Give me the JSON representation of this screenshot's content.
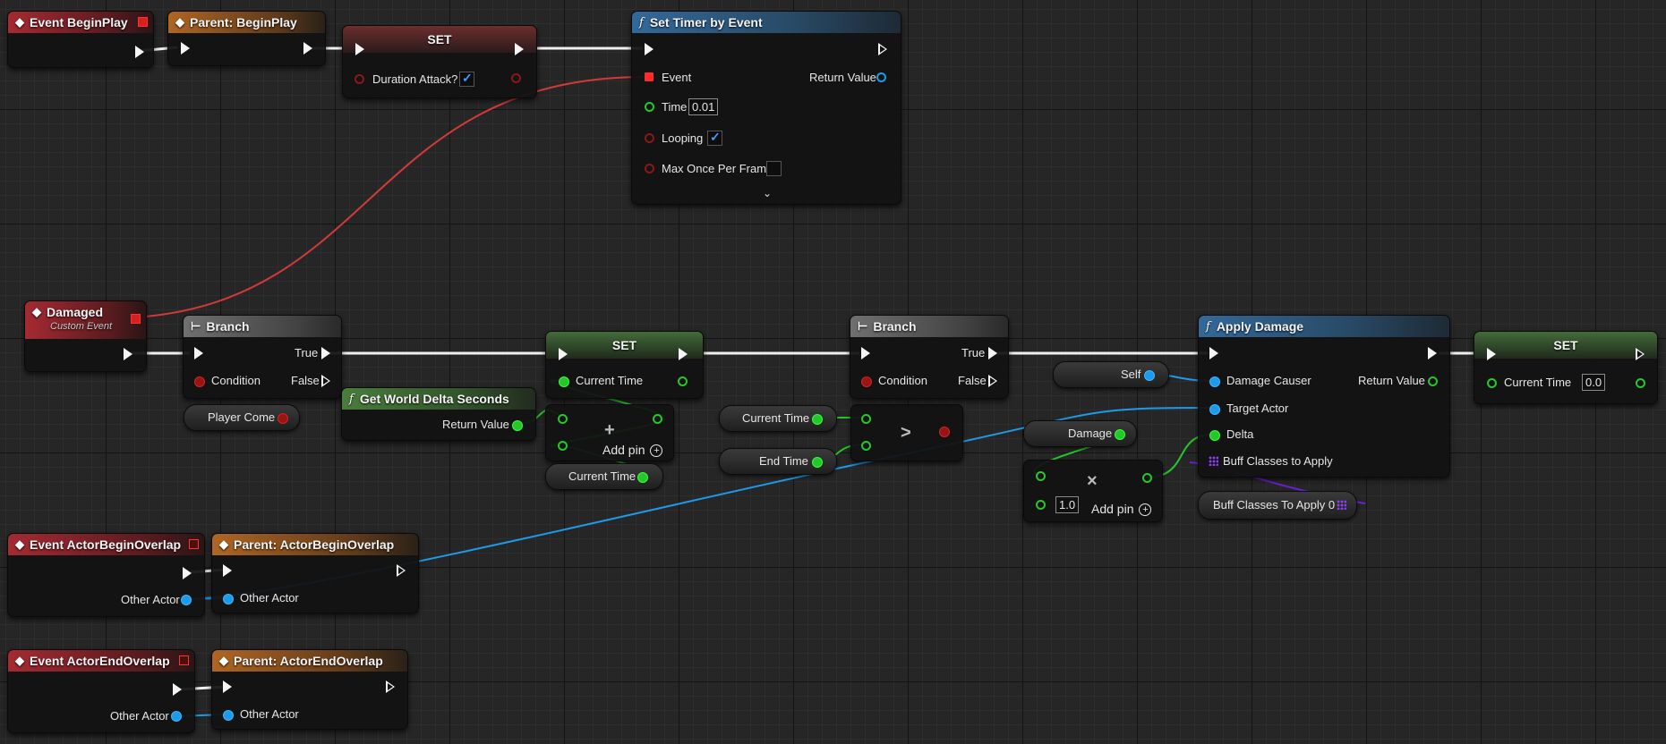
{
  "nodes": {
    "event_begin_play": {
      "title": "Event BeginPlay"
    },
    "parent_begin_play": {
      "title": "Parent: BeginPlay"
    },
    "set_duration": {
      "title": "SET",
      "pin": "Duration Attack?",
      "checked": true
    },
    "set_timer": {
      "title": "Set Timer by Event",
      "event": "Event",
      "return_value": "Return Value",
      "time": "Time",
      "time_value": "0.01",
      "looping": "Looping",
      "looping_checked": true,
      "max_once": "Max Once Per Frame",
      "max_once_checked": false
    },
    "damaged": {
      "title": "Damaged",
      "subtitle": "Custom Event"
    },
    "branch1": {
      "title": "Branch",
      "true_label": "True",
      "false_label": "False",
      "condition": "Condition"
    },
    "player_come": {
      "label": "Player Come"
    },
    "get_world_delta": {
      "title": "Get World Delta Seconds",
      "return_value": "Return Value"
    },
    "set_current_time1": {
      "title": "SET",
      "pin": "Current Time"
    },
    "add_node": {
      "operator": "+",
      "add_pin": "Add pin"
    },
    "current_time_get1": {
      "label": "Current Time"
    },
    "current_time_get2": {
      "label": "Current Time"
    },
    "end_time_get": {
      "label": "End Time"
    },
    "greater_node": {
      "operator": ">"
    },
    "branch2": {
      "title": "Branch",
      "true_label": "True",
      "false_label": "False",
      "condition": "Condition"
    },
    "self_get": {
      "label": "Self"
    },
    "damage_get": {
      "label": "Damage"
    },
    "multiply_node": {
      "operator": "×",
      "value": "1.0",
      "add_pin": "Add pin"
    },
    "apply_damage": {
      "title": "Apply Damage",
      "damage_causer": "Damage Causer",
      "return_value": "Return Value",
      "target_actor": "Target Actor",
      "delta": "Delta",
      "buff_classes": "Buff Classes to Apply"
    },
    "buff_classes_get": {
      "label": "Buff Classes To Apply 0"
    },
    "set_current_time2": {
      "title": "SET",
      "pin": "Current Time",
      "value": "0.0"
    },
    "event_actor_begin_overlap": {
      "title": "Event ActorBeginOverlap",
      "pin": "Other Actor"
    },
    "parent_actor_begin_overlap": {
      "title": "Parent: ActorBeginOverlap",
      "pin": "Other Actor"
    },
    "event_actor_end_overlap": {
      "title": "Event ActorEndOverlap",
      "pin": "Other Actor"
    },
    "parent_actor_end_overlap": {
      "title": "Parent: ActorEndOverlap",
      "pin": "Other Actor"
    }
  },
  "icons": {
    "event": "diamond-event-icon",
    "function": "function-f-icon",
    "branch": "branch-icon",
    "expand": "chevron-down-icon",
    "add": "plus-circle-icon"
  },
  "colors": {
    "exec_wire": "#f0f0f0",
    "float_wire": "#25c72a",
    "object_wire": "#1d9be8",
    "delegate_wire": "#d23a3a",
    "class_array_wire": "#6c1fd8",
    "event_header": "#a52a32",
    "parent_header": "#b06622",
    "function_header": "#32699a",
    "pure_function_header": "#4a7d3c"
  }
}
